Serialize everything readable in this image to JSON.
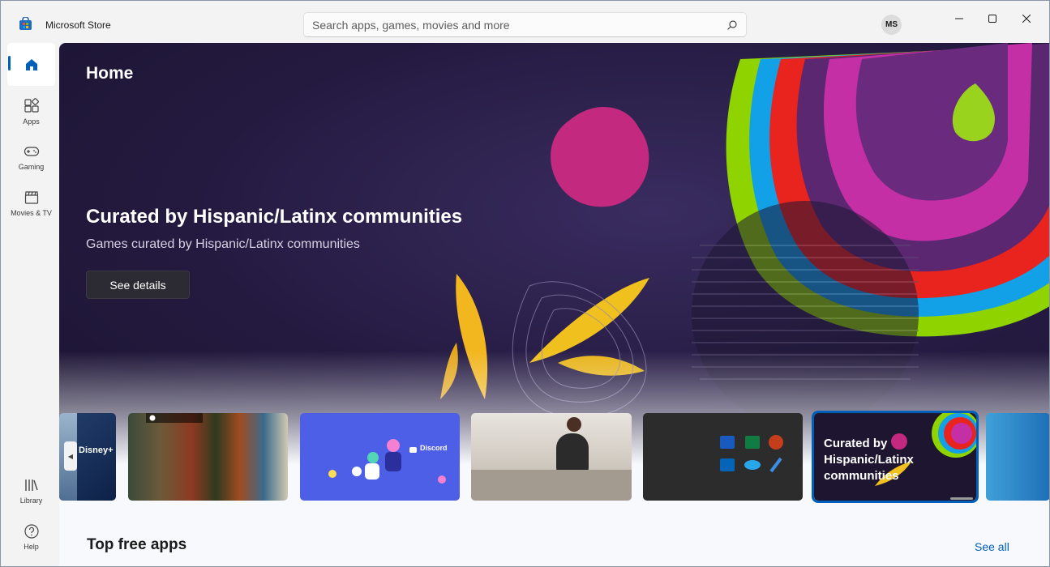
{
  "window": {
    "title": "Microsoft Store",
    "controls": [
      "minimize",
      "maximize",
      "close"
    ]
  },
  "search": {
    "placeholder": "Search apps, games, movies and more"
  },
  "user": {
    "initials": "MS"
  },
  "sidebar": {
    "items": [
      {
        "label": "",
        "icon": "home-icon",
        "active": true
      },
      {
        "label": "Apps",
        "icon": "apps-icon"
      },
      {
        "label": "Gaming",
        "icon": "gamepad-icon"
      },
      {
        "label": "Movies & TV",
        "icon": "clapper-icon"
      }
    ],
    "bottom": [
      {
        "label": "Library",
        "icon": "library-icon"
      },
      {
        "label": "Help",
        "icon": "help-icon"
      }
    ]
  },
  "hero": {
    "page_title": "Home",
    "title": "Curated by Hispanic/Latinx communities",
    "subtitle": "Games curated by Hispanic/Latinx communities",
    "button": "See details"
  },
  "carousel": {
    "cards": [
      {
        "name": "disney",
        "text": "Disney+"
      },
      {
        "name": "gamepass",
        "text": ""
      },
      {
        "name": "discord",
        "text": "Discord"
      },
      {
        "name": "family",
        "text": ""
      },
      {
        "name": "office",
        "text": ""
      },
      {
        "name": "curated",
        "text": "Curated by Hispanic/Latinx communities",
        "selected": true
      },
      {
        "name": "partial",
        "text": ""
      }
    ]
  },
  "section": {
    "title": "Top free apps",
    "see_all": "See all"
  },
  "colors": {
    "accent": "#005fb8",
    "hero_bg": "#241a40"
  }
}
